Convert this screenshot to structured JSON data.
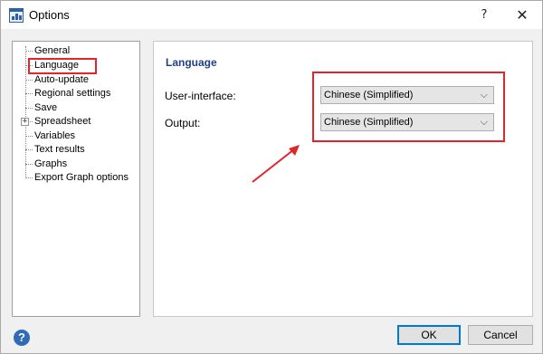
{
  "window": {
    "title": "Options",
    "help_glyph": "?",
    "close_glyph": "✕",
    "app_icon": "chart-app-icon"
  },
  "tree": {
    "expander_glyph": "+",
    "items": [
      {
        "label": "General"
      },
      {
        "label": "Language",
        "selected": true
      },
      {
        "label": "Auto-update"
      },
      {
        "label": "Regional settings"
      },
      {
        "label": "Save"
      },
      {
        "label": "Spreadsheet",
        "expandable": true
      },
      {
        "label": "Variables"
      },
      {
        "label": "Text results"
      },
      {
        "label": "Graphs"
      },
      {
        "label": "Export Graph options"
      }
    ]
  },
  "panel": {
    "title": "Language",
    "fields": [
      {
        "label": "User-interface:",
        "value": "Chinese (Simplified)"
      },
      {
        "label": "Output:",
        "value": "Chinese (Simplified)"
      }
    ],
    "dropdown_icon": "chevron-down-icon",
    "dropdown_glyph": "⌵"
  },
  "footer": {
    "help_glyph": "?",
    "ok_label": "OK",
    "cancel_label": "Cancel"
  },
  "annotation_color": "#e4232a",
  "accent_color": "#0078d7"
}
